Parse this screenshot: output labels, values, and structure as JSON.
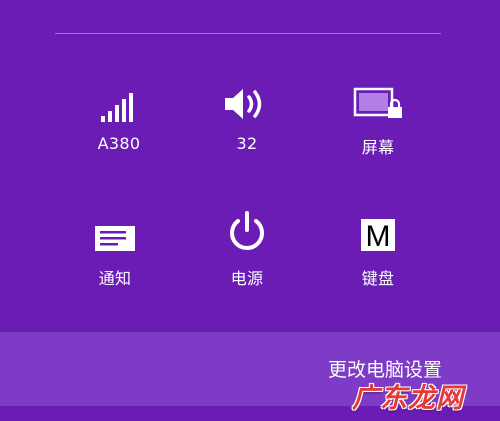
{
  "colors": {
    "background": "#6a1cb5",
    "bottom_bar": "#7d3bc6",
    "foreground": "#ffffff",
    "screen_icon_fill": "#b07ee4",
    "watermark": "#e53935"
  },
  "tiles": [
    {
      "label": "A380",
      "icon": "network-signal-icon"
    },
    {
      "label": "32",
      "icon": "volume-icon"
    },
    {
      "label": "屏幕",
      "icon": "screen-lock-icon"
    },
    {
      "label": "通知",
      "icon": "notifications-icon"
    },
    {
      "label": "电源",
      "icon": "power-icon"
    },
    {
      "label": "键盘",
      "icon": "keyboard-icon"
    }
  ],
  "keyboard_icon_glyph": "M",
  "footer": {
    "pc_settings_label": "更改电脑设置"
  },
  "watermark_text": "广东龙网"
}
